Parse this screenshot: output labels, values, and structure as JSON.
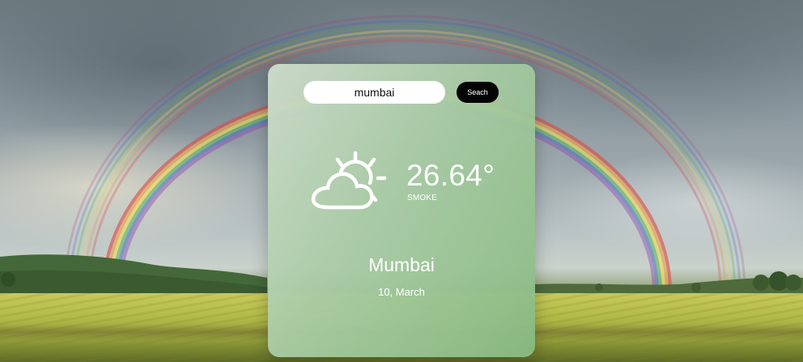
{
  "search": {
    "value": "mumbai",
    "placeholder": "",
    "button_label": "Seach"
  },
  "weather": {
    "icon": "partly-cloudy-icon",
    "temperature": "26.64°",
    "condition": "SMOKE",
    "city": "Mumbai",
    "date": "10, March"
  },
  "colors": {
    "card_tint": "#a8cba4",
    "button": "#050505",
    "text": "#ffffff"
  }
}
